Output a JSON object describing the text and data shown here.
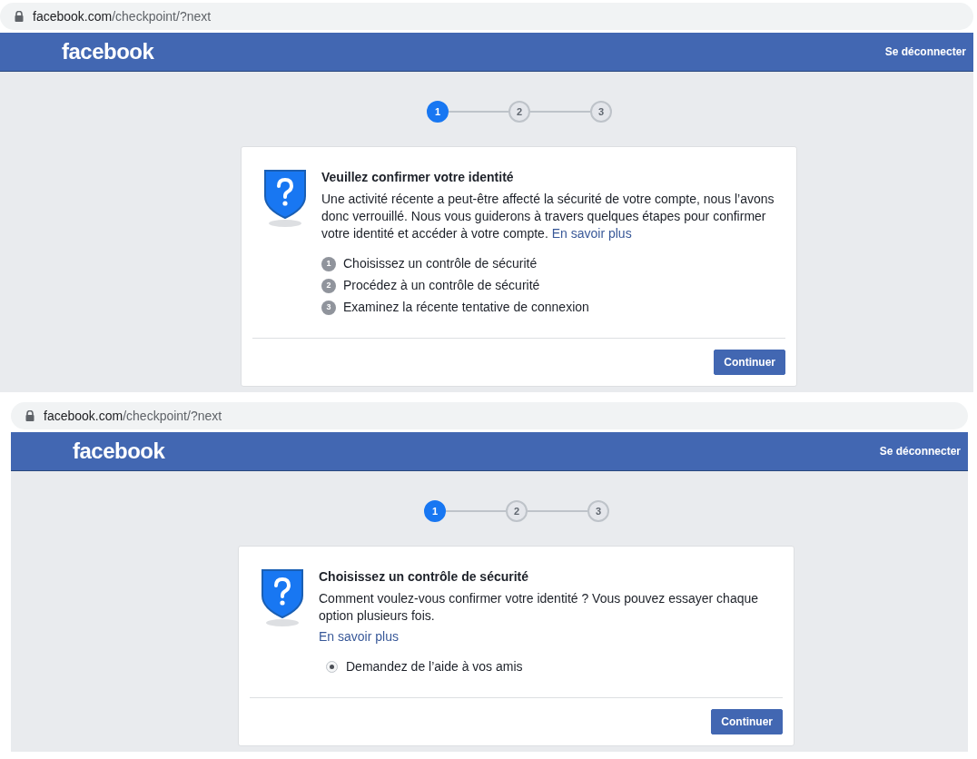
{
  "screens": [
    {
      "address": {
        "domain": "facebook.com",
        "path": "/checkpoint/?next"
      },
      "header": {
        "logo": "facebook",
        "logout": "Se déconnecter"
      },
      "steps": [
        {
          "label": "1",
          "selected": true
        },
        {
          "label": "2",
          "selected": false
        },
        {
          "label": "3",
          "selected": false
        }
      ],
      "card": {
        "kind": "intro",
        "title": "Veuillez confirmer votre identité",
        "body": "Une activité récente a peut-être affecté la sécurité de votre compte, nous l’avons donc verrouillé. Nous vous guiderons à travers quelques étapes pour confirmer votre identité et accéder à votre compte.",
        "link": "En savoir plus",
        "items": [
          {
            "number": "1",
            "label": "Choisissez un contrôle de sécurité"
          },
          {
            "number": "2",
            "label": "Procédez à un contrôle de sécurité"
          },
          {
            "number": "3",
            "label": "Examinez la récente tentative de connexion"
          }
        ],
        "button": "Continuer"
      }
    },
    {
      "address": {
        "domain": "facebook.com",
        "path": "/checkpoint/?next"
      },
      "header": {
        "logo": "facebook",
        "logout": "Se déconnecter"
      },
      "steps": [
        {
          "label": "1",
          "selected": true
        },
        {
          "label": "2",
          "selected": false
        },
        {
          "label": "3",
          "selected": false
        }
      ],
      "card": {
        "kind": "choice",
        "title": "Choisissez un contrôle de sécurité",
        "body": "Comment voulez-vous confirmer votre identité ? Vous pouvez essayer chaque option plusieurs fois.",
        "link": "En savoir plus",
        "options": [
          {
            "label": "Demandez de l’aide à vos amis",
            "selected": true
          }
        ],
        "button": "Continuer"
      }
    }
  ]
}
